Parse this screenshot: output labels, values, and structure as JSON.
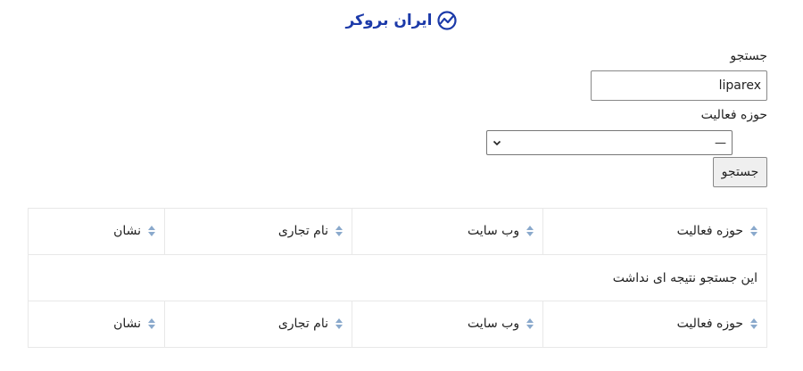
{
  "brand": {
    "name": "ایران بروکر",
    "color": "#1c3aa9"
  },
  "form": {
    "search_label": "جستجو",
    "search_value": "liparex",
    "activity_label": "حوزه فعالیت",
    "activity_selected": "—",
    "search_button": "جستجو"
  },
  "table": {
    "columns": [
      "حوزه فعالیت",
      "وب سایت",
      "نام تجاری",
      "نشان"
    ],
    "empty_message": "این جستجو نتیجه ای نداشت"
  }
}
